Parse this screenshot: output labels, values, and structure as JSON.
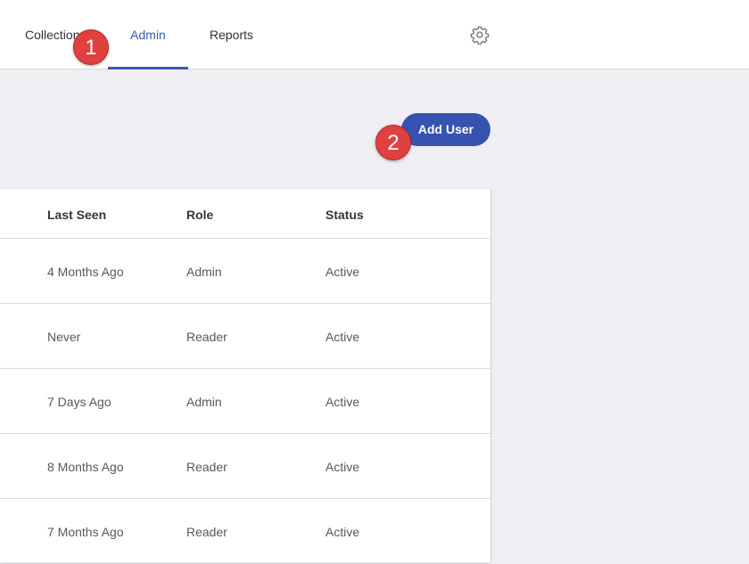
{
  "nav": {
    "tabs": [
      {
        "label": "Collections"
      },
      {
        "label": "Admin",
        "active": true
      },
      {
        "label": "Reports"
      }
    ],
    "settings_icon": "gear-icon"
  },
  "annotations": {
    "badge1": "1",
    "badge2": "2"
  },
  "actions": {
    "add_user_label": "Add User"
  },
  "table": {
    "columns": [
      "Last Seen",
      "Role",
      "Status"
    ],
    "rows": [
      {
        "last_seen": "4 Months Ago",
        "role": "Admin",
        "status": "Active"
      },
      {
        "last_seen": "Never",
        "role": "Reader",
        "status": "Active"
      },
      {
        "last_seen": "7 Days Ago",
        "role": "Admin",
        "status": "Active"
      },
      {
        "last_seen": "8 Months Ago",
        "role": "Reader",
        "status": "Active"
      },
      {
        "last_seen": "7 Months Ago",
        "role": "Reader",
        "status": "Active"
      }
    ]
  },
  "colors": {
    "accent": "#3653b2",
    "badge": "#e0413f",
    "background": "#efeef3"
  }
}
